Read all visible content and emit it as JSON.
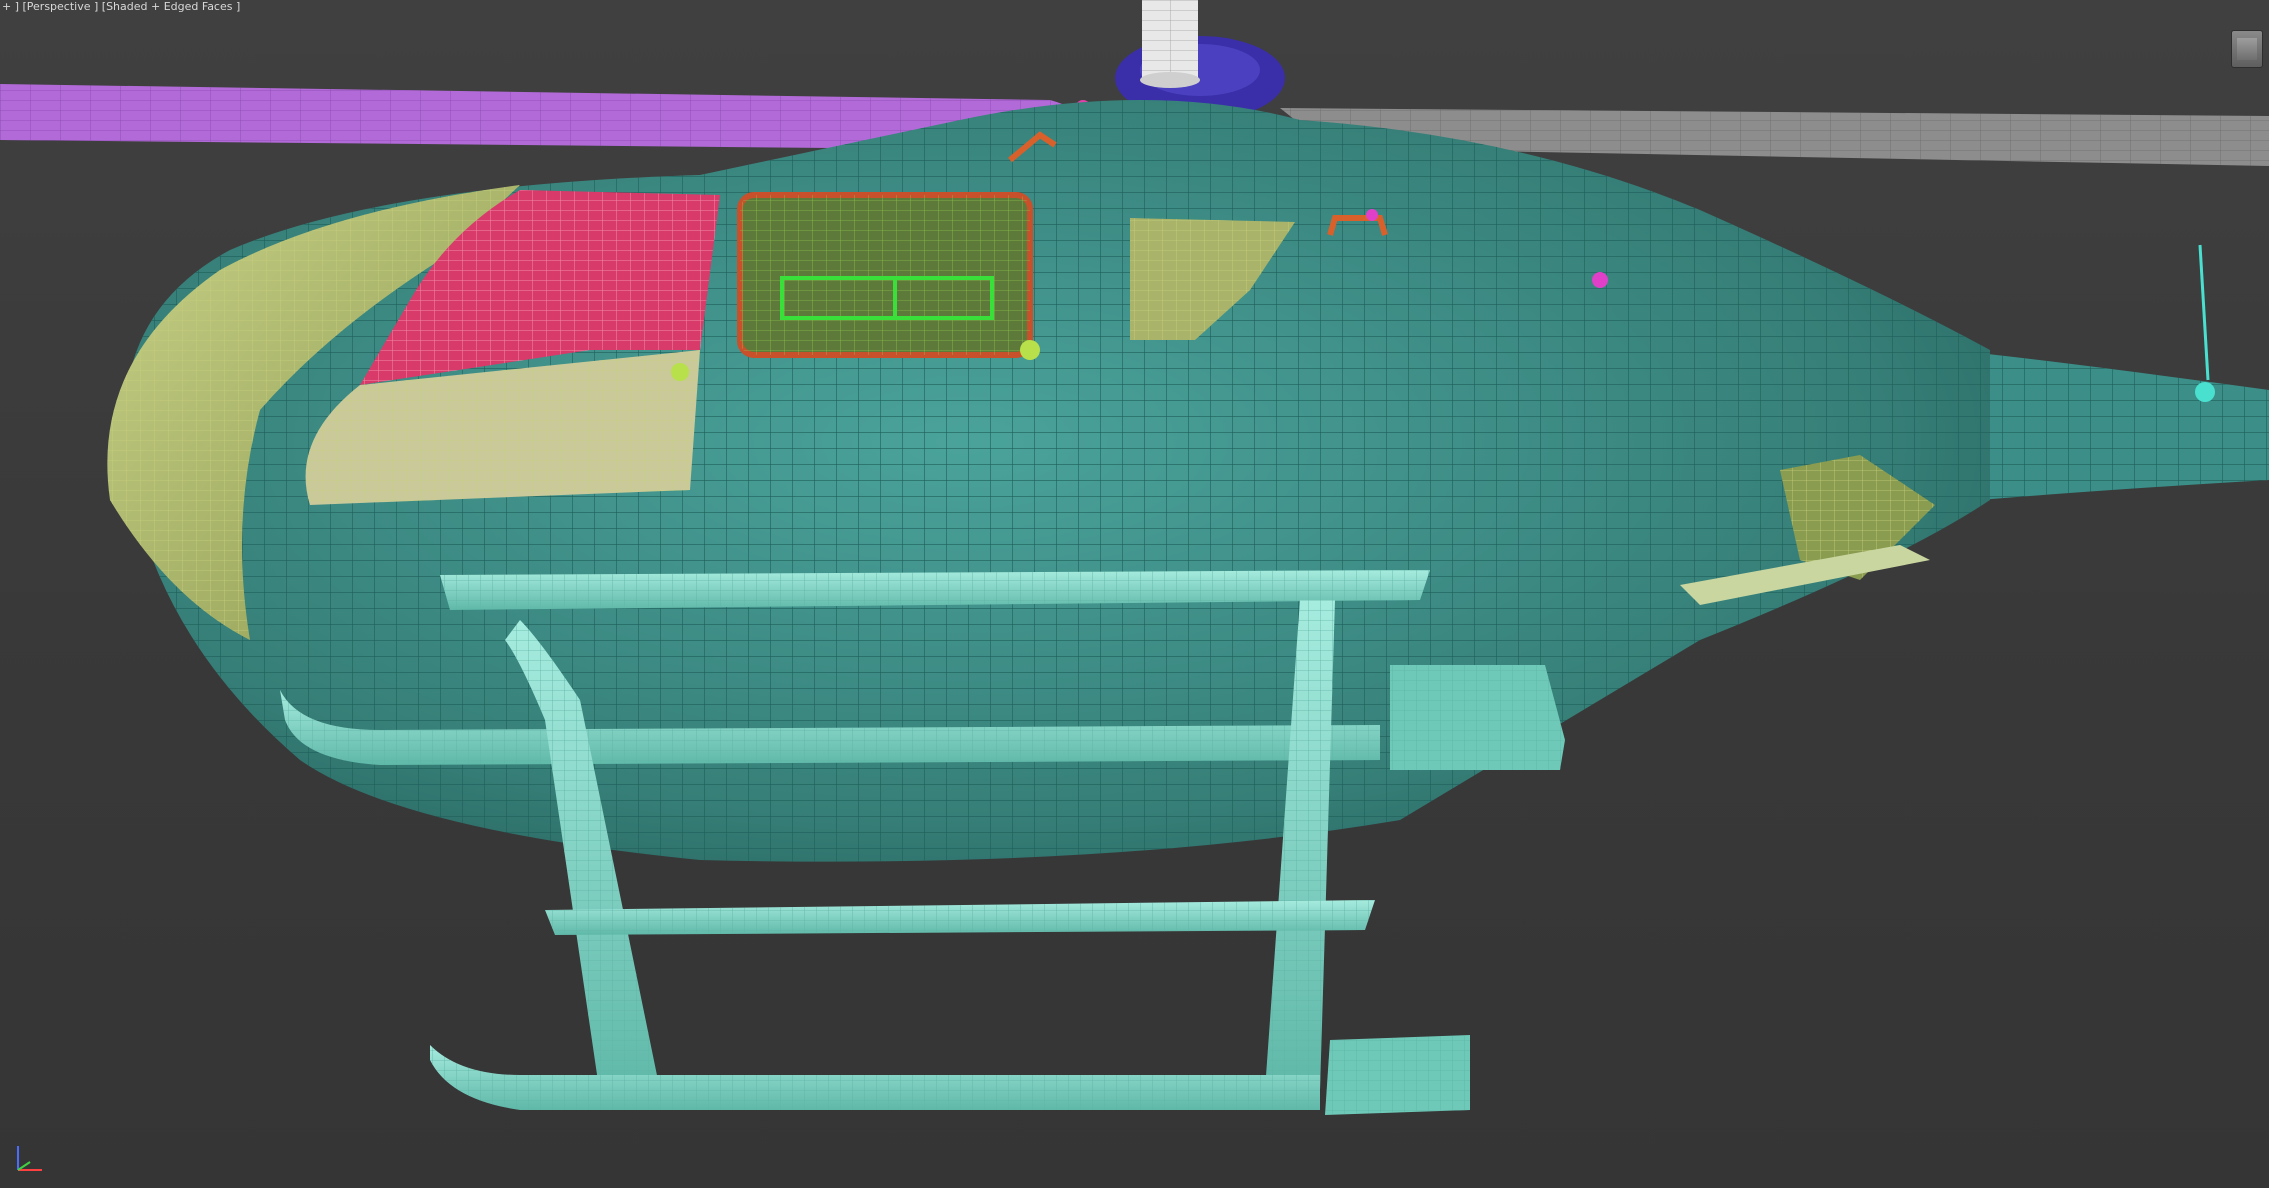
{
  "viewport": {
    "label_prefix": "+ ]",
    "view_name": "Perspective",
    "shading_mode": "Shaded + Edged Faces",
    "label_full": "+ ] [Perspective ] [Shaded + Edged Faces ]"
  },
  "colors": {
    "background": "#3b3b3b",
    "fuselage": "#3b8f88",
    "fuselage_edges": "#1d5a55",
    "skids": "#7fd9c8",
    "main_rotor_blade_left": "#b26ad8",
    "main_rotor_blade_right": "#8e8e8e",
    "rotor_hub": "#3a2fa8",
    "windshield": "#a9b46a",
    "front_window_glass": "#d83a6a",
    "door_window_glass": "#5e7a3a",
    "door_window_frame": "#c8502a",
    "door_window_inner": "#3ae03a",
    "accent_orange": "#d8602a",
    "accent_lime": "#b8e04a",
    "accent_pink": "#e040c8"
  },
  "icons": {
    "viewcube": "viewcube-icon",
    "axis_tripod": "axis-tripod-icon"
  }
}
